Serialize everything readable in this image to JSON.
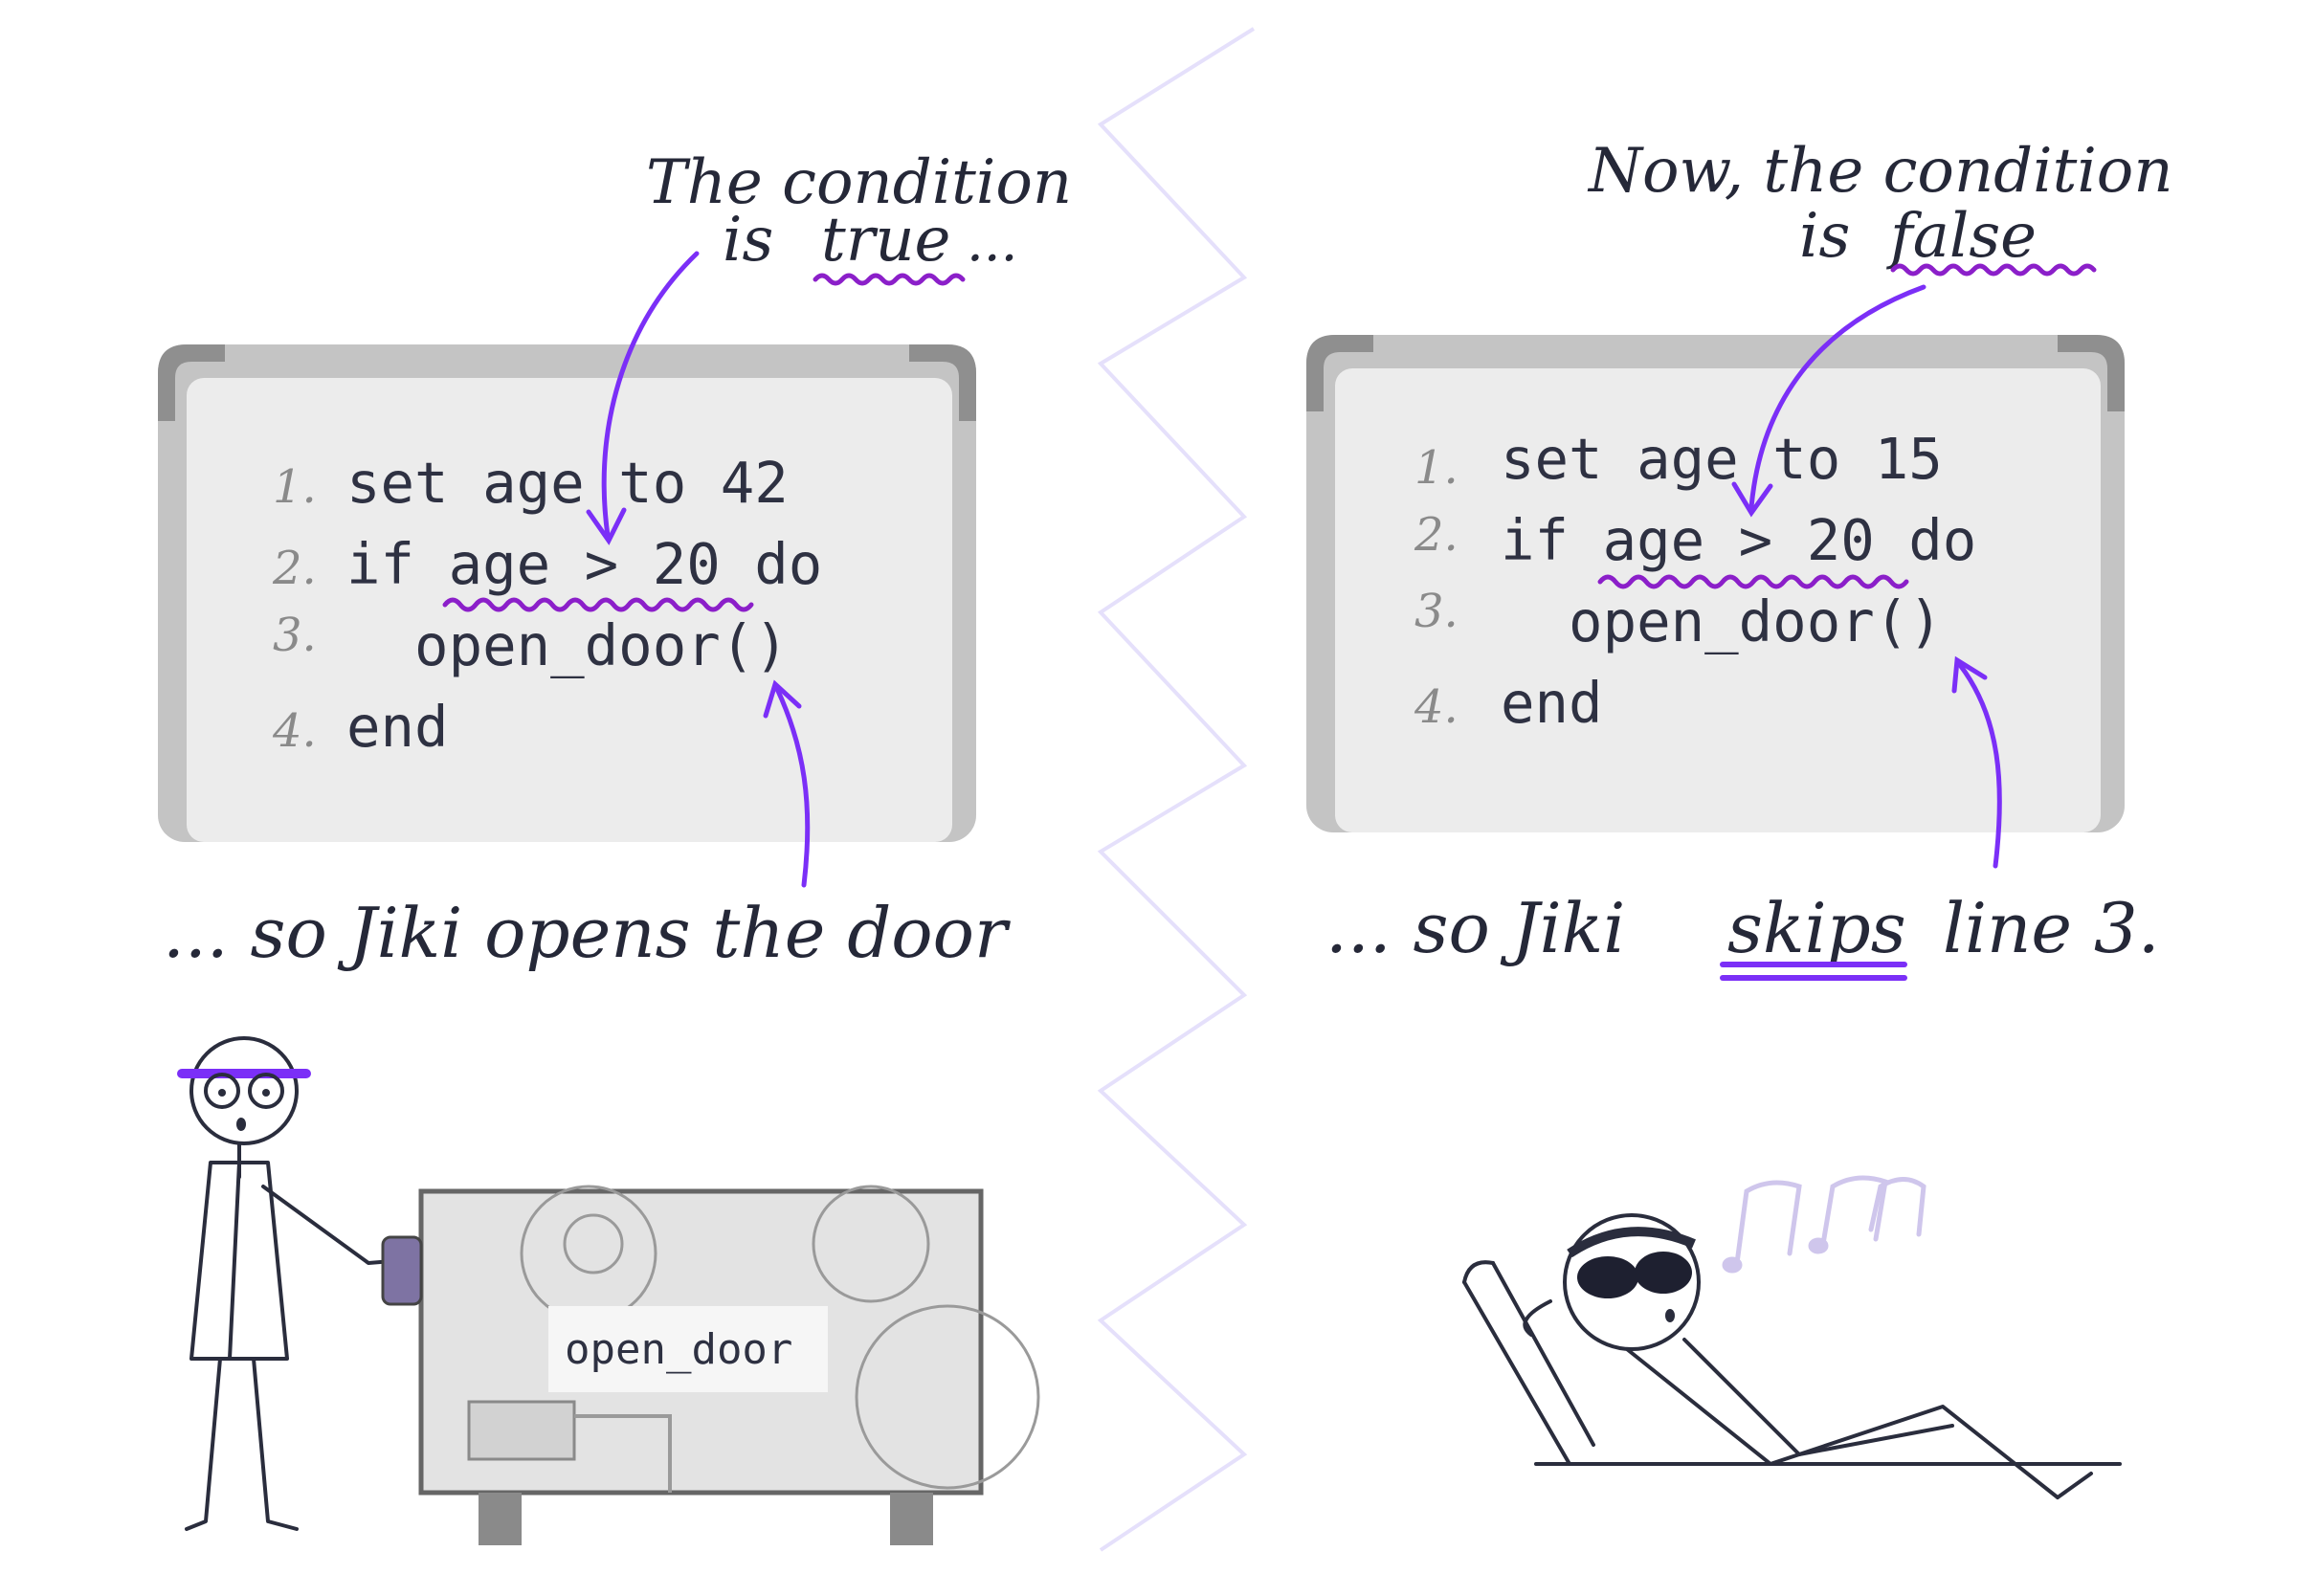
{
  "panels": [
    {
      "annotation_line1": "The condition",
      "annotation_line2_prefix": "is",
      "annotation_line2_word": "true",
      "annotation_line2_suffix": "...",
      "code": [
        {
          "num": "1.",
          "text": "set age to 42"
        },
        {
          "num": "2.",
          "text": "if age > 20 do"
        },
        {
          "num": "3.",
          "text": "  open_door()"
        },
        {
          "num": "4.",
          "text": "end"
        }
      ],
      "caption": "... so Jiki opens the door"
    },
    {
      "annotation_line1": "Now, the condition",
      "annotation_line2_prefix": "is",
      "annotation_line2_word": "false",
      "code": [
        {
          "num": "1.",
          "text": "set age to 15"
        },
        {
          "num": "2.",
          "text": "if age > 20 do"
        },
        {
          "num": "3.",
          "text": "  open_door()"
        },
        {
          "num": "4.",
          "text": "end"
        }
      ],
      "caption_prefix": "... so Jiki",
      "caption_word": "skips",
      "caption_suffix": "line 3."
    }
  ],
  "machine": {
    "label": "open_door"
  },
  "colors": {
    "accent": "#7b2ff7",
    "squiggle": "#8b1fc9",
    "ink": "#2a2d3d"
  }
}
